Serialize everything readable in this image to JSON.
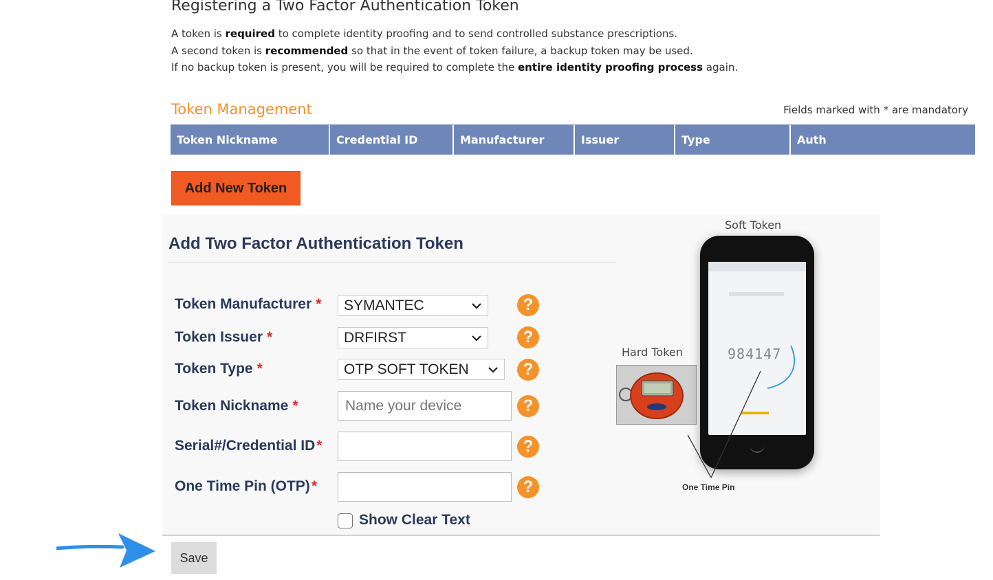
{
  "page": {
    "title": "Registering a Two Factor Authentication Token",
    "intro": [
      {
        "pre": "A token is ",
        "bold": "required",
        "post": " to complete identity proofing and to send controlled substance prescriptions."
      },
      {
        "pre": "A second token is ",
        "bold": "recommended",
        "post": " so that in the event of token failure, a backup token may be used."
      },
      {
        "pre": "If no backup token is present, you will be required to complete the ",
        "bold": "entire identity proofing process",
        "post": " again."
      }
    ]
  },
  "token_management": {
    "title": "Token Management",
    "mandatory_note": "Fields marked with * are mandatory",
    "columns": [
      "Token Nickname",
      "Credential ID",
      "Manufacturer",
      "Issuer",
      "Type",
      "Auth"
    ],
    "add_button": "Add New Token"
  },
  "form": {
    "title": "Add Two Factor Authentication Token",
    "fields": {
      "manufacturer": {
        "label": "Token Manufacturer",
        "req": "*",
        "value": "SYMANTEC"
      },
      "issuer": {
        "label": "Token Issuer",
        "req": "*",
        "value": "DRFIRST"
      },
      "type": {
        "label": "Token Type",
        "req": "*",
        "value": "OTP SOFT TOKEN"
      },
      "nickname": {
        "label": "Token Nickname",
        "req": "*",
        "placeholder": "Name your device"
      },
      "serial": {
        "label": "Serial#/Credential ID",
        "req": "*",
        "value": ""
      },
      "otp": {
        "label": "One Time Pin (OTP)",
        "req": "*",
        "value": ""
      }
    },
    "help_glyph": "?",
    "show_clear_text": "Show Clear Text",
    "save": "Save"
  },
  "illustration": {
    "soft_token_label": "Soft Token",
    "hard_token_label": "Hard Token",
    "otp_caption": "One Time Pin",
    "phone_code": "984147"
  },
  "colors": {
    "accent_orange": "#f15a22",
    "heading_orange": "#f5922a",
    "table_header": "#6f86b9",
    "label_navy": "#2b3a5c",
    "arrow_blue": "#2f8fe8"
  },
  "icons": [
    "chevron-down-icon",
    "help-icon",
    "arrow-right-icon"
  ]
}
